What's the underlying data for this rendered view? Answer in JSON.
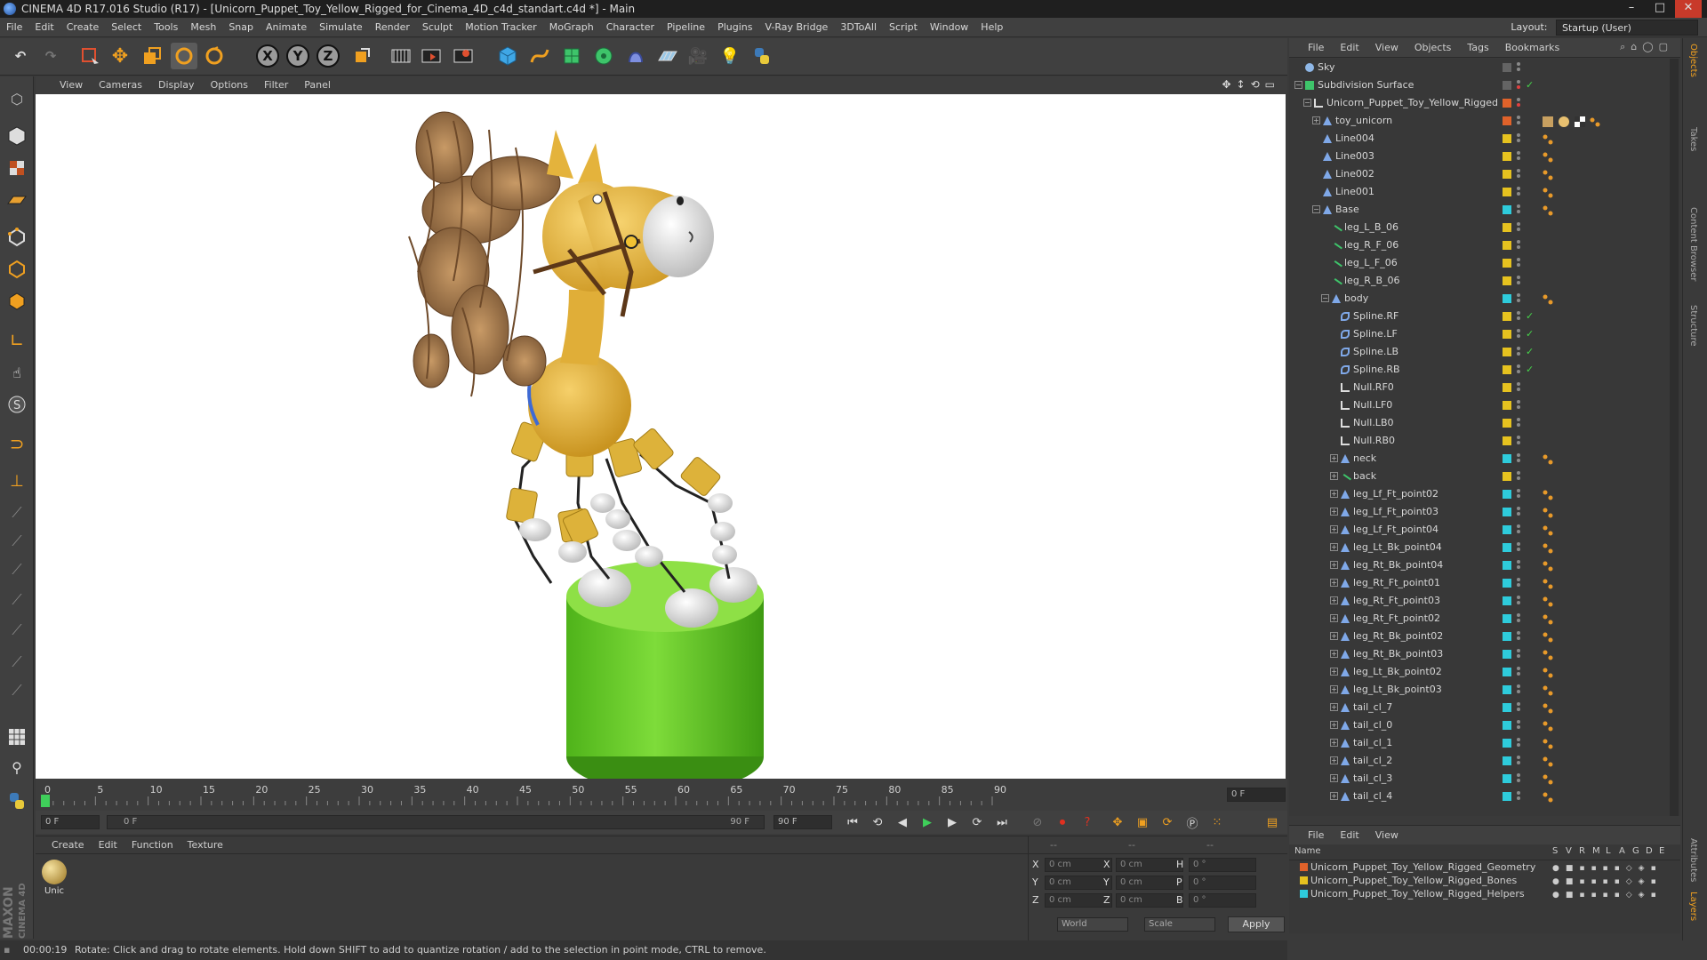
{
  "window": {
    "title": "CINEMA 4D R17.016 Studio (R17) - [Unicorn_Puppet_Toy_Yellow_Rigged_for_Cinema_4D_c4d_standart.c4d *] - Main",
    "minimize": "–",
    "maximize": "□",
    "close": "✕"
  },
  "menubar": [
    "File",
    "Edit",
    "Create",
    "Select",
    "Tools",
    "Mesh",
    "Snap",
    "Animate",
    "Simulate",
    "Render",
    "Sculpt",
    "Motion Tracker",
    "MoGraph",
    "Character",
    "Pipeline",
    "Plugins",
    "V-Ray Bridge",
    "3DToAll",
    "Script",
    "Window",
    "Help"
  ],
  "layout": {
    "label": "Layout:",
    "value": "Startup (User)"
  },
  "toolbar_axes": [
    "X",
    "Y",
    "Z"
  ],
  "viewport_menu": [
    "View",
    "Cameras",
    "Display",
    "Options",
    "Filter",
    "Panel"
  ],
  "timeline": {
    "ticks": [
      "0",
      "5",
      "10",
      "15",
      "20",
      "25",
      "30",
      "35",
      "40",
      "45",
      "50",
      "55",
      "60",
      "65",
      "70",
      "75",
      "80",
      "85",
      "90"
    ],
    "end_field": "0 F",
    "current_frame_field": "0 F",
    "range_start": "0 F",
    "range_end": "90 F",
    "max_field": "90 F"
  },
  "materials": {
    "menu": [
      "Create",
      "Edit",
      "Function",
      "Texture"
    ],
    "items": [
      {
        "label": "Unic"
      }
    ]
  },
  "coords": {
    "rows": [
      {
        "a": "X",
        "av": "0 cm",
        "b": "X",
        "bv": "0 cm",
        "c": "H",
        "cv": "0 °"
      },
      {
        "a": "Y",
        "av": "0 cm",
        "b": "Y",
        "bv": "0 cm",
        "c": "P",
        "cv": "0 °"
      },
      {
        "a": "Z",
        "av": "0 cm",
        "b": "Z",
        "bv": "0 cm",
        "c": "B",
        "cv": "0 °"
      }
    ],
    "headers": [
      "--",
      "--",
      "--"
    ],
    "mode": "World",
    "transform": "Scale",
    "apply": "Apply"
  },
  "status": {
    "time": "00:00:19",
    "message": "Rotate: Click and drag to rotate elements. Hold down SHIFT to add to quantize rotation / add to the selection in point mode, CTRL to remove."
  },
  "object_manager": {
    "menu": [
      "File",
      "Edit",
      "View",
      "Objects",
      "Tags",
      "Bookmarks"
    ],
    "objects": [
      {
        "name": "Sky",
        "indent": 0,
        "icon": "sky",
        "layer": "",
        "exp": "",
        "chk": false,
        "tag": ""
      },
      {
        "name": "Subdivision Surface",
        "indent": 0,
        "icon": "subdiv",
        "layer": "",
        "exp": "−",
        "chk": true,
        "tag": ""
      },
      {
        "name": "Unicorn_Puppet_Toy_Yellow_Rigged",
        "indent": 1,
        "icon": "null",
        "layer": "#e0622a",
        "exp": "−",
        "chk": false,
        "tag": ""
      },
      {
        "name": "toy_unicorn",
        "indent": 2,
        "icon": "bone",
        "layer": "#e0622a",
        "exp": "+",
        "chk": false,
        "tag": "mat"
      },
      {
        "name": "Line004",
        "indent": 2,
        "icon": "bone",
        "layer": "#e6c21f",
        "exp": "",
        "chk": false,
        "tag": "dot"
      },
      {
        "name": "Line003",
        "indent": 2,
        "icon": "bone",
        "layer": "#e6c21f",
        "exp": "",
        "chk": false,
        "tag": "dot"
      },
      {
        "name": "Line002",
        "indent": 2,
        "icon": "bone",
        "layer": "#e6c21f",
        "exp": "",
        "chk": false,
        "tag": "dot"
      },
      {
        "name": "Line001",
        "indent": 2,
        "icon": "bone",
        "layer": "#e6c21f",
        "exp": "",
        "chk": false,
        "tag": "dot"
      },
      {
        "name": "Base",
        "indent": 2,
        "icon": "bone",
        "layer": "#2ecbdb",
        "exp": "−",
        "chk": false,
        "tag": "dot"
      },
      {
        "name": "leg_L_B_06",
        "indent": 3,
        "icon": "spline",
        "layer": "#e6c21f",
        "exp": "",
        "chk": false,
        "tag": ""
      },
      {
        "name": "leg_R_F_06",
        "indent": 3,
        "icon": "spline",
        "layer": "#e6c21f",
        "exp": "",
        "chk": false,
        "tag": ""
      },
      {
        "name": "leg_L_F_06",
        "indent": 3,
        "icon": "spline",
        "layer": "#e6c21f",
        "exp": "",
        "chk": false,
        "tag": ""
      },
      {
        "name": "leg_R_B_06",
        "indent": 3,
        "icon": "spline",
        "layer": "#e6c21f",
        "exp": "",
        "chk": false,
        "tag": ""
      },
      {
        "name": "body",
        "indent": 3,
        "icon": "bone",
        "layer": "#2ecbdb",
        "exp": "−",
        "chk": false,
        "tag": "dot"
      },
      {
        "name": "Spline.RF",
        "indent": 4,
        "icon": "curve",
        "layer": "#e6c21f",
        "exp": "",
        "chk": true,
        "tag": ""
      },
      {
        "name": "Spline.LF",
        "indent": 4,
        "icon": "curve",
        "layer": "#e6c21f",
        "exp": "",
        "chk": true,
        "tag": ""
      },
      {
        "name": "Spline.LB",
        "indent": 4,
        "icon": "curve",
        "layer": "#e6c21f",
        "exp": "",
        "chk": true,
        "tag": ""
      },
      {
        "name": "Spline.RB",
        "indent": 4,
        "icon": "curve",
        "layer": "#e6c21f",
        "exp": "",
        "chk": true,
        "tag": ""
      },
      {
        "name": "Null.RF0",
        "indent": 4,
        "icon": "null",
        "layer": "#e6c21f",
        "exp": "",
        "chk": false,
        "tag": ""
      },
      {
        "name": "Null.LF0",
        "indent": 4,
        "icon": "null",
        "layer": "#e6c21f",
        "exp": "",
        "chk": false,
        "tag": ""
      },
      {
        "name": "Null.LB0",
        "indent": 4,
        "icon": "null",
        "layer": "#e6c21f",
        "exp": "",
        "chk": false,
        "tag": ""
      },
      {
        "name": "Null.RB0",
        "indent": 4,
        "icon": "null",
        "layer": "#e6c21f",
        "exp": "",
        "chk": false,
        "tag": ""
      },
      {
        "name": "neck",
        "indent": 4,
        "icon": "bone",
        "layer": "#2ecbdb",
        "exp": "+",
        "chk": false,
        "tag": "dot"
      },
      {
        "name": "back",
        "indent": 4,
        "icon": "spline",
        "layer": "#e6c21f",
        "exp": "+",
        "chk": false,
        "tag": ""
      },
      {
        "name": "leg_Lf_Ft_point02",
        "indent": 4,
        "icon": "bone",
        "layer": "#2ecbdb",
        "exp": "+",
        "chk": false,
        "tag": "dot"
      },
      {
        "name": "leg_Lf_Ft_point03",
        "indent": 4,
        "icon": "bone",
        "layer": "#2ecbdb",
        "exp": "+",
        "chk": false,
        "tag": "dot"
      },
      {
        "name": "leg_Lf_Ft_point04",
        "indent": 4,
        "icon": "bone",
        "layer": "#2ecbdb",
        "exp": "+",
        "chk": false,
        "tag": "dot"
      },
      {
        "name": "leg_Lt_Bk_point04",
        "indent": 4,
        "icon": "bone",
        "layer": "#2ecbdb",
        "exp": "+",
        "chk": false,
        "tag": "dot"
      },
      {
        "name": "leg_Rt_Bk_point04",
        "indent": 4,
        "icon": "bone",
        "layer": "#2ecbdb",
        "exp": "+",
        "chk": false,
        "tag": "dot"
      },
      {
        "name": "leg_Rt_Ft_point01",
        "indent": 4,
        "icon": "bone",
        "layer": "#2ecbdb",
        "exp": "+",
        "chk": false,
        "tag": "dot"
      },
      {
        "name": "leg_Rt_Ft_point03",
        "indent": 4,
        "icon": "bone",
        "layer": "#2ecbdb",
        "exp": "+",
        "chk": false,
        "tag": "dot"
      },
      {
        "name": "leg_Rt_Ft_point02",
        "indent": 4,
        "icon": "bone",
        "layer": "#2ecbdb",
        "exp": "+",
        "chk": false,
        "tag": "dot"
      },
      {
        "name": "leg_Rt_Bk_point02",
        "indent": 4,
        "icon": "bone",
        "layer": "#2ecbdb",
        "exp": "+",
        "chk": false,
        "tag": "dot"
      },
      {
        "name": "leg_Rt_Bk_point03",
        "indent": 4,
        "icon": "bone",
        "layer": "#2ecbdb",
        "exp": "+",
        "chk": false,
        "tag": "dot"
      },
      {
        "name": "leg_Lt_Bk_point02",
        "indent": 4,
        "icon": "bone",
        "layer": "#2ecbdb",
        "exp": "+",
        "chk": false,
        "tag": "dot"
      },
      {
        "name": "leg_Lt_Bk_point03",
        "indent": 4,
        "icon": "bone",
        "layer": "#2ecbdb",
        "exp": "+",
        "chk": false,
        "tag": "dot"
      },
      {
        "name": "tail_cl_7",
        "indent": 4,
        "icon": "bone",
        "layer": "#2ecbdb",
        "exp": "+",
        "chk": false,
        "tag": "dot"
      },
      {
        "name": "tail_cl_0",
        "indent": 4,
        "icon": "bone",
        "layer": "#2ecbdb",
        "exp": "+",
        "chk": false,
        "tag": "dot"
      },
      {
        "name": "tail_cl_1",
        "indent": 4,
        "icon": "bone",
        "layer": "#2ecbdb",
        "exp": "+",
        "chk": false,
        "tag": "dot"
      },
      {
        "name": "tail_cl_2",
        "indent": 4,
        "icon": "bone",
        "layer": "#2ecbdb",
        "exp": "+",
        "chk": false,
        "tag": "dot"
      },
      {
        "name": "tail_cl_3",
        "indent": 4,
        "icon": "bone",
        "layer": "#2ecbdb",
        "exp": "+",
        "chk": false,
        "tag": "dot"
      },
      {
        "name": "tail_cl_4",
        "indent": 4,
        "icon": "bone",
        "layer": "#2ecbdb",
        "exp": "+",
        "chk": false,
        "tag": "dot"
      }
    ]
  },
  "layer_manager": {
    "menu": [
      "File",
      "Edit",
      "View"
    ],
    "columns": [
      "Name",
      "S",
      "V",
      "R",
      "M",
      "L",
      "A",
      "G",
      "D",
      "E"
    ],
    "layers": [
      {
        "name": "Unicorn_Puppet_Toy_Yellow_Rigged_Geometry",
        "color": "#e0622a"
      },
      {
        "name": "Unicorn_Puppet_Toy_Yellow_Rigged_Bones",
        "color": "#e6c21f"
      },
      {
        "name": "Unicorn_Puppet_Toy_Yellow_Rigged_Helpers",
        "color": "#2ecbdb"
      }
    ]
  },
  "side_tabs": [
    "Objects",
    "Takes",
    "Content Browser",
    "Structure",
    "Attributes",
    "Layers"
  ],
  "brand": [
    "MAXON",
    "CINEMA 4D"
  ]
}
